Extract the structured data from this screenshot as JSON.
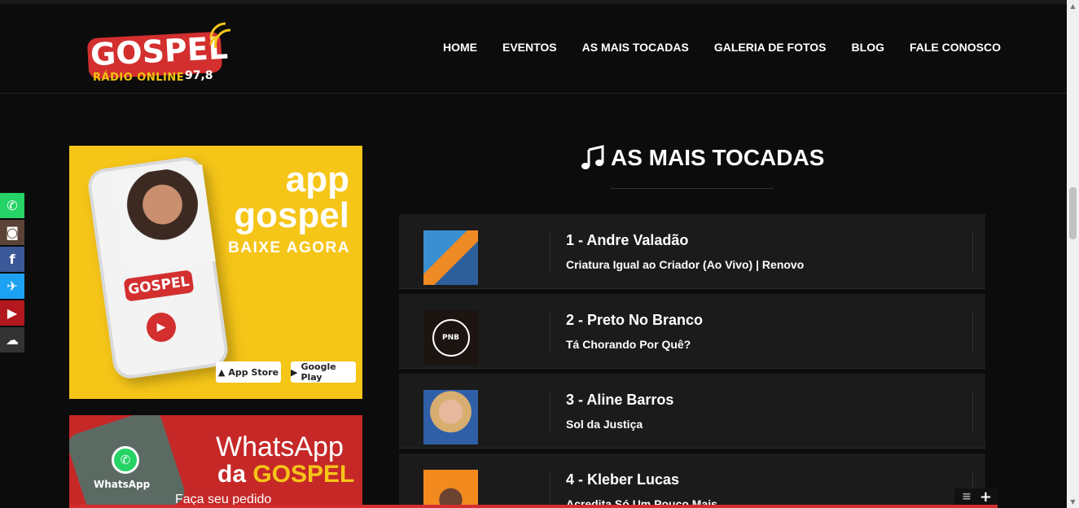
{
  "logo": {
    "main": "GOSPEL",
    "sub": "RÁDIO ONLINE",
    "frequency": "97,8"
  },
  "nav": {
    "items": [
      "HOME",
      "EVENTOS",
      "AS MAIS TOCADAS",
      "GALERIA DE FOTOS",
      "BLOG",
      "FALE CONOSCO"
    ]
  },
  "social": {
    "items": [
      {
        "name": "whatsapp-icon",
        "glyph": "✆",
        "color": "#25d366"
      },
      {
        "name": "instagram-icon",
        "glyph": "◙",
        "color": "#5a4336"
      },
      {
        "name": "facebook-icon",
        "glyph": "f",
        "color": "#3b5998"
      },
      {
        "name": "twitter-icon",
        "glyph": "✈",
        "color": "#1da1f2"
      },
      {
        "name": "youtube-icon",
        "glyph": "▶",
        "color": "#b2181e"
      },
      {
        "name": "soundcloud-icon",
        "glyph": "☁",
        "color": "#333333"
      }
    ]
  },
  "banner_app": {
    "line1": "app",
    "line2": "gospel",
    "cta": "BAIXE AGORA",
    "app_store": "App Store",
    "google_play": "Google Play",
    "phone_logo": "GOSPEL"
  },
  "banner_whatsapp": {
    "line1": "WhatsApp",
    "line2_prefix": "da ",
    "line2_highlight": "GOSPEL",
    "line3": "Faça seu pedido",
    "phone_label": "WhatsApp"
  },
  "section": {
    "title": "AS MAIS TOCADAS"
  },
  "tracks": [
    {
      "artist": "1 - Andre Valadão",
      "song": "Criatura Igual ao Criador (Ao Vivo) | Renovo"
    },
    {
      "artist": "2 - Preto No Branco",
      "song": "Tá Chorando Por Quê?"
    },
    {
      "artist": "3 - Aline Barros",
      "song": "Sol da Justiça"
    },
    {
      "artist": "4 - Kleber Lucas",
      "song": "Acredita Só Um Pouco Mais"
    }
  ],
  "player": {
    "menu_icon": "≡",
    "add_icon": "+"
  }
}
